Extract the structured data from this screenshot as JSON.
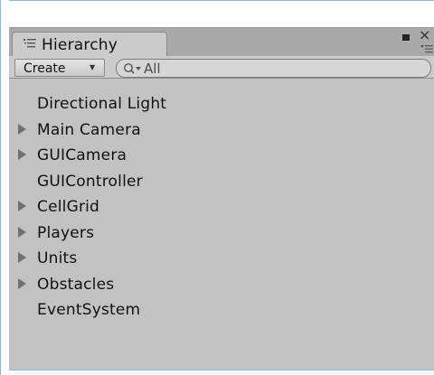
{
  "window": {
    "tab_title": "Hierarchy",
    "tab_icon": "list-icon",
    "controls": {
      "maximize_icon": "maximize-icon",
      "close_glyph": "×",
      "menu_icon": "panel-menu-icon"
    }
  },
  "toolbar": {
    "create_label": "Create",
    "create_caret": "▼",
    "search_placeholder": "All",
    "search_value": "",
    "search_icon": "search-icon"
  },
  "hierarchy": {
    "items": [
      {
        "label": "Directional Light",
        "expandable": false
      },
      {
        "label": "Main Camera",
        "expandable": true
      },
      {
        "label": "GUICamera",
        "expandable": true
      },
      {
        "label": "GUIController",
        "expandable": false
      },
      {
        "label": "CellGrid",
        "expandable": true
      },
      {
        "label": "Players",
        "expandable": true
      },
      {
        "label": "Units",
        "expandable": true
      },
      {
        "label": "Obstacles",
        "expandable": true
      },
      {
        "label": "EventSystem",
        "expandable": false
      }
    ]
  },
  "colors": {
    "panel_bg": "#c2c2c2",
    "tab_bg": "#cbcbcb",
    "tabstrip_bg": "#a9a9a9",
    "window_edge": "#8fb6dc",
    "arrow": "#707070"
  }
}
